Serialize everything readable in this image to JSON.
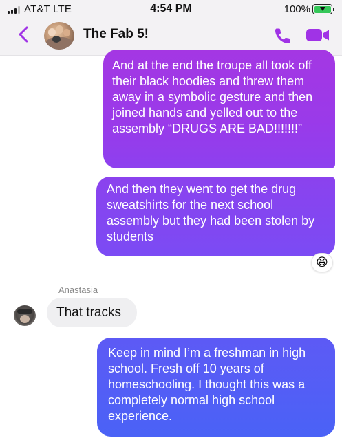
{
  "status_bar": {
    "carrier": "AT&T  LTE",
    "time": "4:54 PM",
    "battery_percent": "100%",
    "signal_bars": 3,
    "charging": true
  },
  "header": {
    "title": "The Fab 5!",
    "back_icon": "chevron-left-icon",
    "call_icon": "phone-icon",
    "video_icon": "video-camera-icon",
    "accent_color": "#a033e6"
  },
  "messages": [
    {
      "direction": "outgoing",
      "text": "And at the end the troupe all took off their black hoodies and threw them away in a symbolic gesture and then joined hands and yelled out to the assembly “DRUGS ARE BAD!!!!!!!”"
    },
    {
      "direction": "outgoing",
      "text": "And then they went to get the drug sweatshirts for the next school assembly but they had been stolen by students",
      "reaction": "😆"
    },
    {
      "direction": "incoming",
      "sender": "Anastasia",
      "text": "That tracks"
    },
    {
      "direction": "outgoing",
      "text": "Keep in mind I’m a freshman in high school. Fresh off 10 years of homeschooling. I thought this was a completely normal high school experience."
    }
  ]
}
